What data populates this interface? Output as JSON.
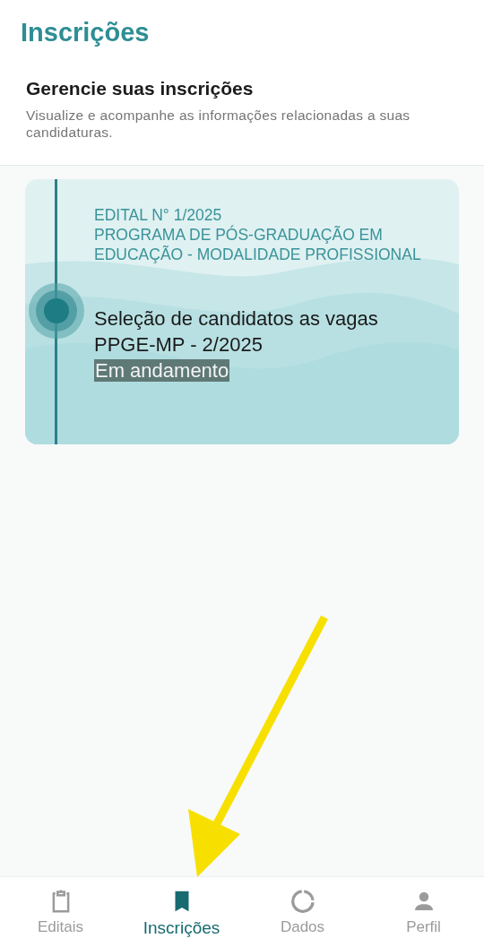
{
  "header": {
    "title": "Inscrições"
  },
  "intro": {
    "heading": "Gerencie suas inscrições",
    "description": "Visualize e acompanhe as informações relacionadas a suas candidaturas."
  },
  "enrollments": [
    {
      "notice": "EDITAL N° 1/2025",
      "program": "PROGRAMA DE PÓS-GRADUAÇÃO EM EDUCAÇÃO - MODALIDADE PROFISSIONAL",
      "title": "Seleção de candidatos as vagas PPGE-MP - 2/2025",
      "status": "Em andamento"
    }
  ],
  "bottom_nav": [
    {
      "label": "Editais",
      "kind": "clipboard",
      "selected": false
    },
    {
      "label": "Inscrições",
      "kind": "bookmark",
      "selected": true
    },
    {
      "label": "Dados",
      "kind": "ring",
      "selected": false
    },
    {
      "label": "Perfil",
      "kind": "person",
      "selected": false
    }
  ]
}
